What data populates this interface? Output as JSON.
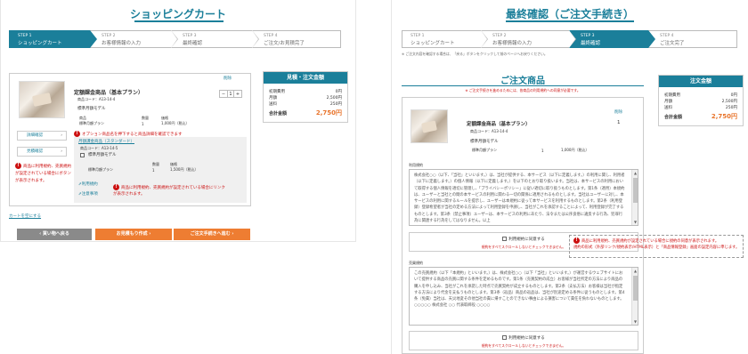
{
  "left": {
    "title": "ショッピングカート",
    "steps": [
      {
        "num": "STEP 1",
        "label": "ショッピングカート"
      },
      {
        "num": "STEP 2",
        "label": "お客様情報の入力"
      },
      {
        "num": "STEP 3",
        "label": "最終確認"
      },
      {
        "num": "STEP 4",
        "label": "ご注文/お見積完了"
      }
    ],
    "delete_link": "削除",
    "product_name": "定額課金商品（基本プラン）",
    "product_code": "商品コード：A13-14-4",
    "product_option": "標準月額モデル",
    "qty": "1",
    "qty_minus": "−",
    "qty_plus": "+",
    "line_table_header": [
      "商品",
      "数量",
      "価格"
    ],
    "line_table_rows": [
      [
        "標準月額プラン",
        "1",
        "1,000円（税込）"
      ]
    ],
    "detail_button": "詳細確認",
    "terms_button": "見積確認",
    "callout_option": "オプション商品名を押下すると商品詳細を確認できます",
    "option_name": "月額課金商品（スタンダード）",
    "option_code": "商品コード：A13-14-5",
    "option_item": "標準月額モデル",
    "option_table_header": [
      "数量",
      "価格"
    ],
    "option_table_rows": [
      [
        "標準月額プラン",
        "1",
        "1,500円（税込）"
      ]
    ],
    "terms_link_a": "利用規約",
    "terms_link_b": "注意事項",
    "callout_terms_link": "商品に利用規約、売買規約が設定されている場合にリンクが表示されます。",
    "callout_button": "商品に利用規約、売買規約が設定されている場合にボタンが表示されます。",
    "summary": {
      "title": "見積・注文金額",
      "rows": [
        {
          "label": "初期費用",
          "value": "0円"
        },
        {
          "label": "月額",
          "value": "2,500円"
        },
        {
          "label": "送料",
          "value": "250円"
        }
      ],
      "total_label": "合計金額",
      "total_value": "2,750円"
    },
    "clear_link": "カートを空にする",
    "buttons": {
      "back": "買い物へ戻る",
      "quote": "お見積もり作成",
      "order": "ご注文手続きへ進む"
    }
  },
  "right": {
    "title": "最終確認（ご注文手続き）",
    "steps": [
      {
        "num": "STEP 1",
        "label": "ショッピングカート"
      },
      {
        "num": "STEP 2",
        "label": "お客様情報の入力"
      },
      {
        "num": "STEP 3",
        "label": "最終確認"
      },
      {
        "num": "STEP 4",
        "label": "ご注文完了"
      }
    ],
    "note_top": "※ ご注文内容を確認する場合は、「戻る」ボタンをクリックして前のページへお戻りください。",
    "section_title": "ご注文商品",
    "section_note": "※ ご注文手続きを進めるためには、各商品の利用規約への同意が必要です。",
    "delete_link": "削除",
    "product_name": "定額課金商品（基本プラン）",
    "product_code": "商品コード：A13-14-4",
    "qty": "1",
    "product_option": "標準月額モデル",
    "line_table_rows": [
      [
        "標準月額プラン",
        "1",
        "1,000円（税込）"
      ]
    ],
    "terms1_label": "利用規約",
    "terms1_text": "株式会社○○（以下、「当社」といいます。）は、当社が提供する、本サービス（以下に定義します。）の利用に関し、利用者（以下に定義します。）の個人情報（以下に定義します。）を以下のとおり取り扱います。当社は、本サービスの利用において取得する個人情報を適切に管理し、「プライバシーポリシー」に従い適切に取り扱うものとします。第1条（適用）本規約は、ユーザーと当社との間の本サービスの利用に関わる一切の関係に適用されるものとします。当社はユーザーに対し、本サービスの利用に関するルールを提示し、ユーザーは本規約に従って本サービスを利用するものとします。第2条（利用登録）登録希望者が当社の定める方法によって利用登録を申請し、当社がこれを承認することによって、利用登録が完了するものとします。第3条（禁止事項）ユーザーは、本サービスの利用にあたり、法令または公序良俗に違反する行為、犯罪行為に関連する行為をしてはなりません。以上",
    "agree1_text": "利用規約に同意する",
    "agree1_sub": "規約をすべてスクロールしないとチェックできません。",
    "callout_agree": "商品に利用規約、売買規約が設定されている場合に規約の同意が表示されます。",
    "callout_agree2": "規約の形式（外部リンク/規約表示/HTML表示）と「商品情報登録」画面の設定内容に準じます。",
    "terms2_label": "売買規約",
    "terms2_text": "この売買規約（以下「本規約」といいます。）は、株式会社○○（以下「当社」といいます。）が運営するウェブサイトにおいて提供する商品の売買に関する条件を定めるものです。第1条（売買契約の成立）お客様が当社所定の方法により商品の購入を申し込み、当社がこれを承諾した時点で売買契約が成立するものとします。第2条（支払方法）お客様は当社が指定する方法により代金を支払うものとします。第3条（返品）商品の返品は、当社が別途定める条件に従うものとします。第4条（免責）当社は、天災地変その他当社の責に帰すことのできない事由による損害について責任を負わないものとします。○○○○○ 株式会社 ○○ 代表取締役 ○○○○",
    "agree2_text": "利用規約に同意する",
    "agree2_sub": "規約をすべてスクロールしないとチェックできません。",
    "summary": {
      "title": "注文金額",
      "rows": [
        {
          "label": "初期費用",
          "value": "0円"
        },
        {
          "label": "月額",
          "value": "2,500円"
        },
        {
          "label": "送料",
          "value": "250円"
        }
      ],
      "total_label": "合計金額",
      "total_value": "2,750円"
    }
  }
}
